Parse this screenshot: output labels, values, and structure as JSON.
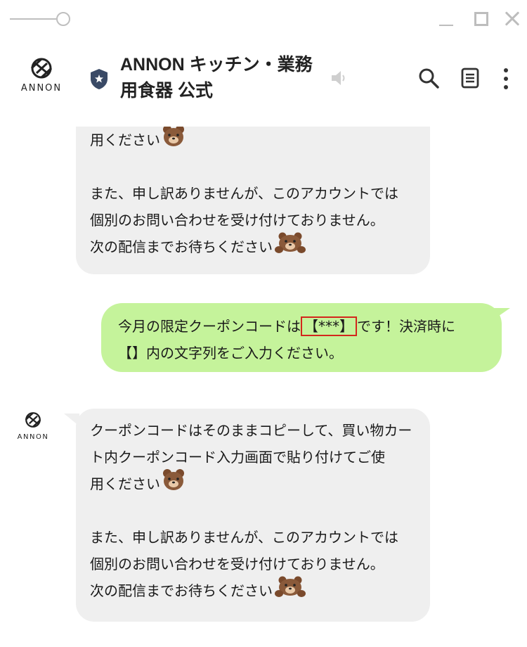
{
  "window": {
    "controls": [
      "minimize",
      "maximize",
      "close"
    ]
  },
  "header": {
    "logo_text": "ANNON",
    "title_line1": "ANNON キッチン・業務",
    "title_line2": "用食器 公式",
    "icons": [
      "shield-icon",
      "speaker-icon",
      "search-icon",
      "note-icon",
      "more-icon"
    ]
  },
  "messages": {
    "top": {
      "lines": [
        "用ください",
        "",
        "また、申し訳ありませんが、このアカウントでは",
        "個別のお問い合わせを受け付けておりません。",
        "次の配信までお待ちください"
      ]
    },
    "outgoing": {
      "line1_before": "今月の限定クーポンコードは",
      "line1_code": "【***】",
      "line1_after": "です！決済時に",
      "line2": "【】内の文字列をご入力ください。"
    },
    "bottom": {
      "sender": "ANNON",
      "lines": [
        "クーポンコードはそのままコピーして、買い物カー",
        "ト内クーポンコード入力画面で貼り付けてご使",
        "用ください",
        "",
        "また、申し訳ありませんが、このアカウントでは",
        "個別のお問い合わせを受け付けておりません。",
        "次の配信までお待ちください"
      ]
    }
  },
  "colors": {
    "incoming_bubble": "#efefef",
    "outgoing_bubble": "#c5f39b",
    "code_highlight_border": "#d3271c",
    "bear_brown": "#8a5a3a"
  }
}
